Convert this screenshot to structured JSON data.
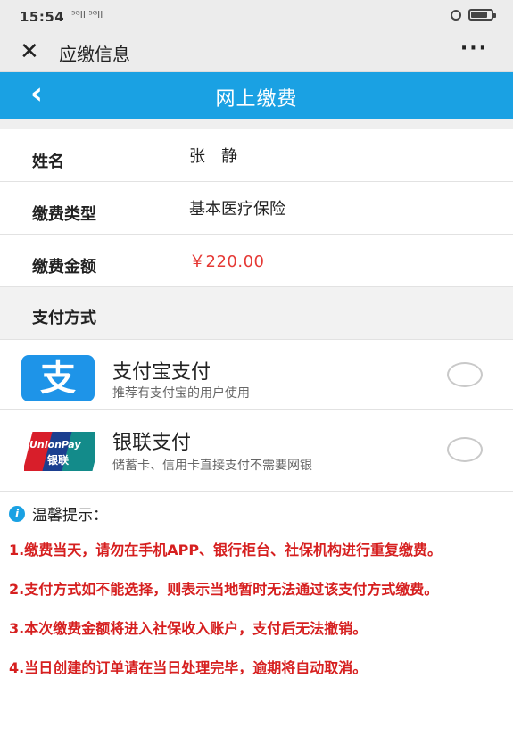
{
  "status_bar": {
    "time": "15:54",
    "signal": "⁵ᴳil ⁵ᴳil"
  },
  "wechat_bar": {
    "close_icon": "close-icon",
    "title": "应缴信息",
    "more_icon": "more-icon"
  },
  "app_bar": {
    "back_icon": "chevron-left-icon",
    "title": "网上缴费"
  },
  "info": {
    "name_label": "姓名",
    "name_value": "张　静",
    "type_label": "缴费类型",
    "type_value": "基本医疗保险",
    "amount_label": "缴费金额",
    "amount_value": "￥220.00"
  },
  "payment": {
    "section_label": "支付方式",
    "options": [
      {
        "title": "支付宝支付",
        "desc": "推荐有支付宝的用户使用",
        "logo": "支"
      },
      {
        "title": "银联支付",
        "desc": "储蓄卡、信用卡直接支付不需要网银",
        "logo_text": "UnionPay",
        "logo_text2": "银联"
      }
    ]
  },
  "tips": {
    "header": "温馨提示：",
    "items": [
      "1.缴费当天，请勿在手机APP、银行柜台、社保机构进行重复缴费。",
      "2.支付方式如不能选择，则表示当地暂时无法通过该支付方式缴费。",
      "3.本次缴费金额将进入社保收入账户，支付后无法撤销。",
      "4.当日创建的订单请在当日处理完毕，逾期将自动取消。"
    ]
  },
  "colors": {
    "accent": "#1aa1e3",
    "money": "#e53935",
    "tips": "#d61f1f"
  }
}
